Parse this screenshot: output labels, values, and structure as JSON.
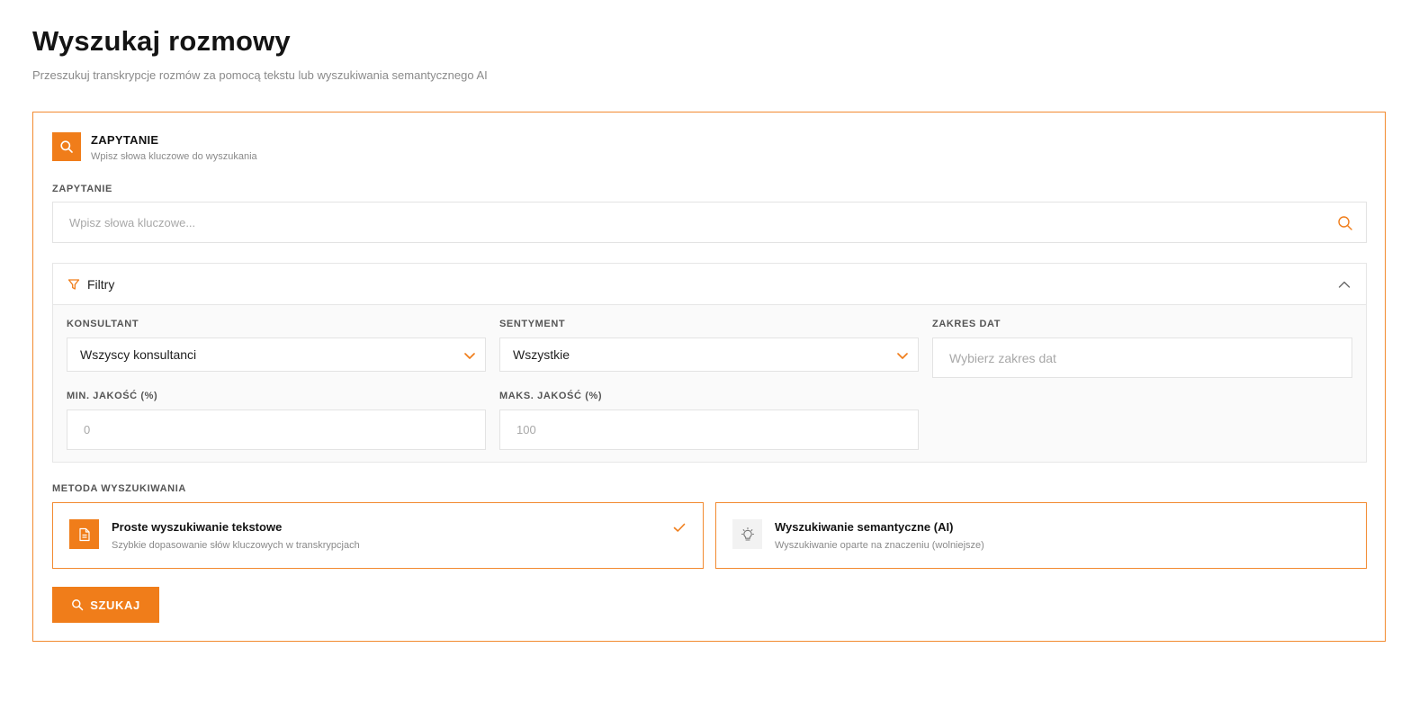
{
  "page": {
    "title": "Wyszukaj rozmowy",
    "subtitle": "Przeszukuj transkrypcje rozmów za pomocą tekstu lub wyszukiwania semantycznego AI"
  },
  "card": {
    "title": "ZAPYTANIE",
    "subtitle": "Wpisz słowa kluczowe do wyszukania",
    "icon": "search-icon"
  },
  "query": {
    "label": "ZAPYTANIE",
    "placeholder": "Wpisz słowa kluczowe...",
    "value": ""
  },
  "filters": {
    "title": "Filtry",
    "expanded": true,
    "consultant": {
      "label": "KONSULTANT",
      "selected": "Wszyscy konsultanci"
    },
    "sentiment": {
      "label": "SENTYMENT",
      "selected": "Wszystkie"
    },
    "date_range": {
      "label": "ZAKRES DAT",
      "placeholder": "Wybierz zakres dat"
    },
    "min_quality": {
      "label": "MIN. JAKOŚĆ (%)",
      "placeholder": "0"
    },
    "max_quality": {
      "label": "MAKS. JAKOŚĆ (%)",
      "placeholder": "100"
    }
  },
  "method": {
    "label": "METODA WYSZUKIWANIA",
    "options": [
      {
        "title": "Proste wyszukiwanie tekstowe",
        "description": "Szybkie dopasowanie słów kluczowych w transkrypcjach",
        "icon": "document-icon",
        "selected": true
      },
      {
        "title": "Wyszukiwanie semantyczne (AI)",
        "description": "Wyszukiwanie oparte na znaczeniu (wolniejsze)",
        "icon": "lightbulb-icon",
        "selected": false
      }
    ]
  },
  "search_button": {
    "label": "SZUKAJ"
  },
  "colors": {
    "accent": "#f07d1a",
    "border_accent": "#f28a30",
    "muted_text": "#8a8a8a"
  }
}
